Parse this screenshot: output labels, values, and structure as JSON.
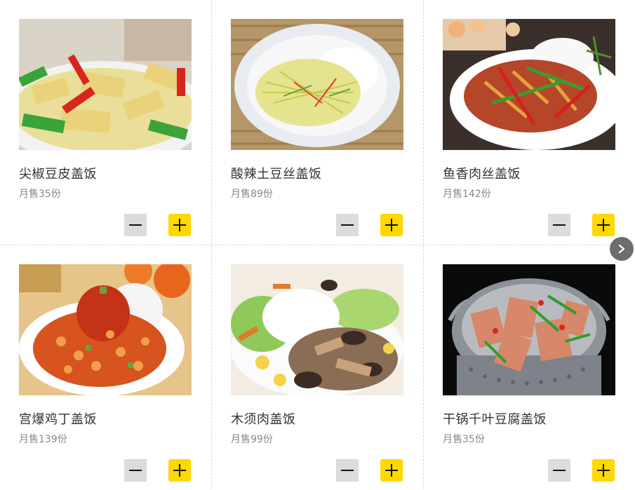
{
  "items": [
    {
      "name": "尖椒豆皮盖饭",
      "sales": "月售35份",
      "image": "tofu-skin-with-green-pepper-photo"
    },
    {
      "name": "酸辣土豆丝盖饭",
      "sales": "月售89份",
      "image": "hot-sour-potato-shreds-rice-photo"
    },
    {
      "name": "鱼香肉丝盖饭",
      "sales": "月售142份",
      "image": "yuxiang-shredded-pork-photo"
    },
    {
      "name": "宫爆鸡丁盖饭",
      "sales": "月售139份",
      "image": "kung-pao-chicken-rice-photo"
    },
    {
      "name": "木须肉盖饭",
      "sales": "月售99份",
      "image": "moo-shu-pork-rice-photo"
    },
    {
      "name": "干锅千叶豆腐盖饭",
      "sales": "月售35份",
      "image": "dry-pot-tofu-photo"
    }
  ],
  "controls": {
    "minus_icon": "minus-icon",
    "plus_icon": "plus-icon",
    "next_icon": "chevron-right-icon"
  },
  "colors": {
    "plus_button": "#ffd800",
    "minus_button": "#dcdcdc",
    "next_button": "#6d6d6d",
    "divider": "#d6d6d6"
  }
}
